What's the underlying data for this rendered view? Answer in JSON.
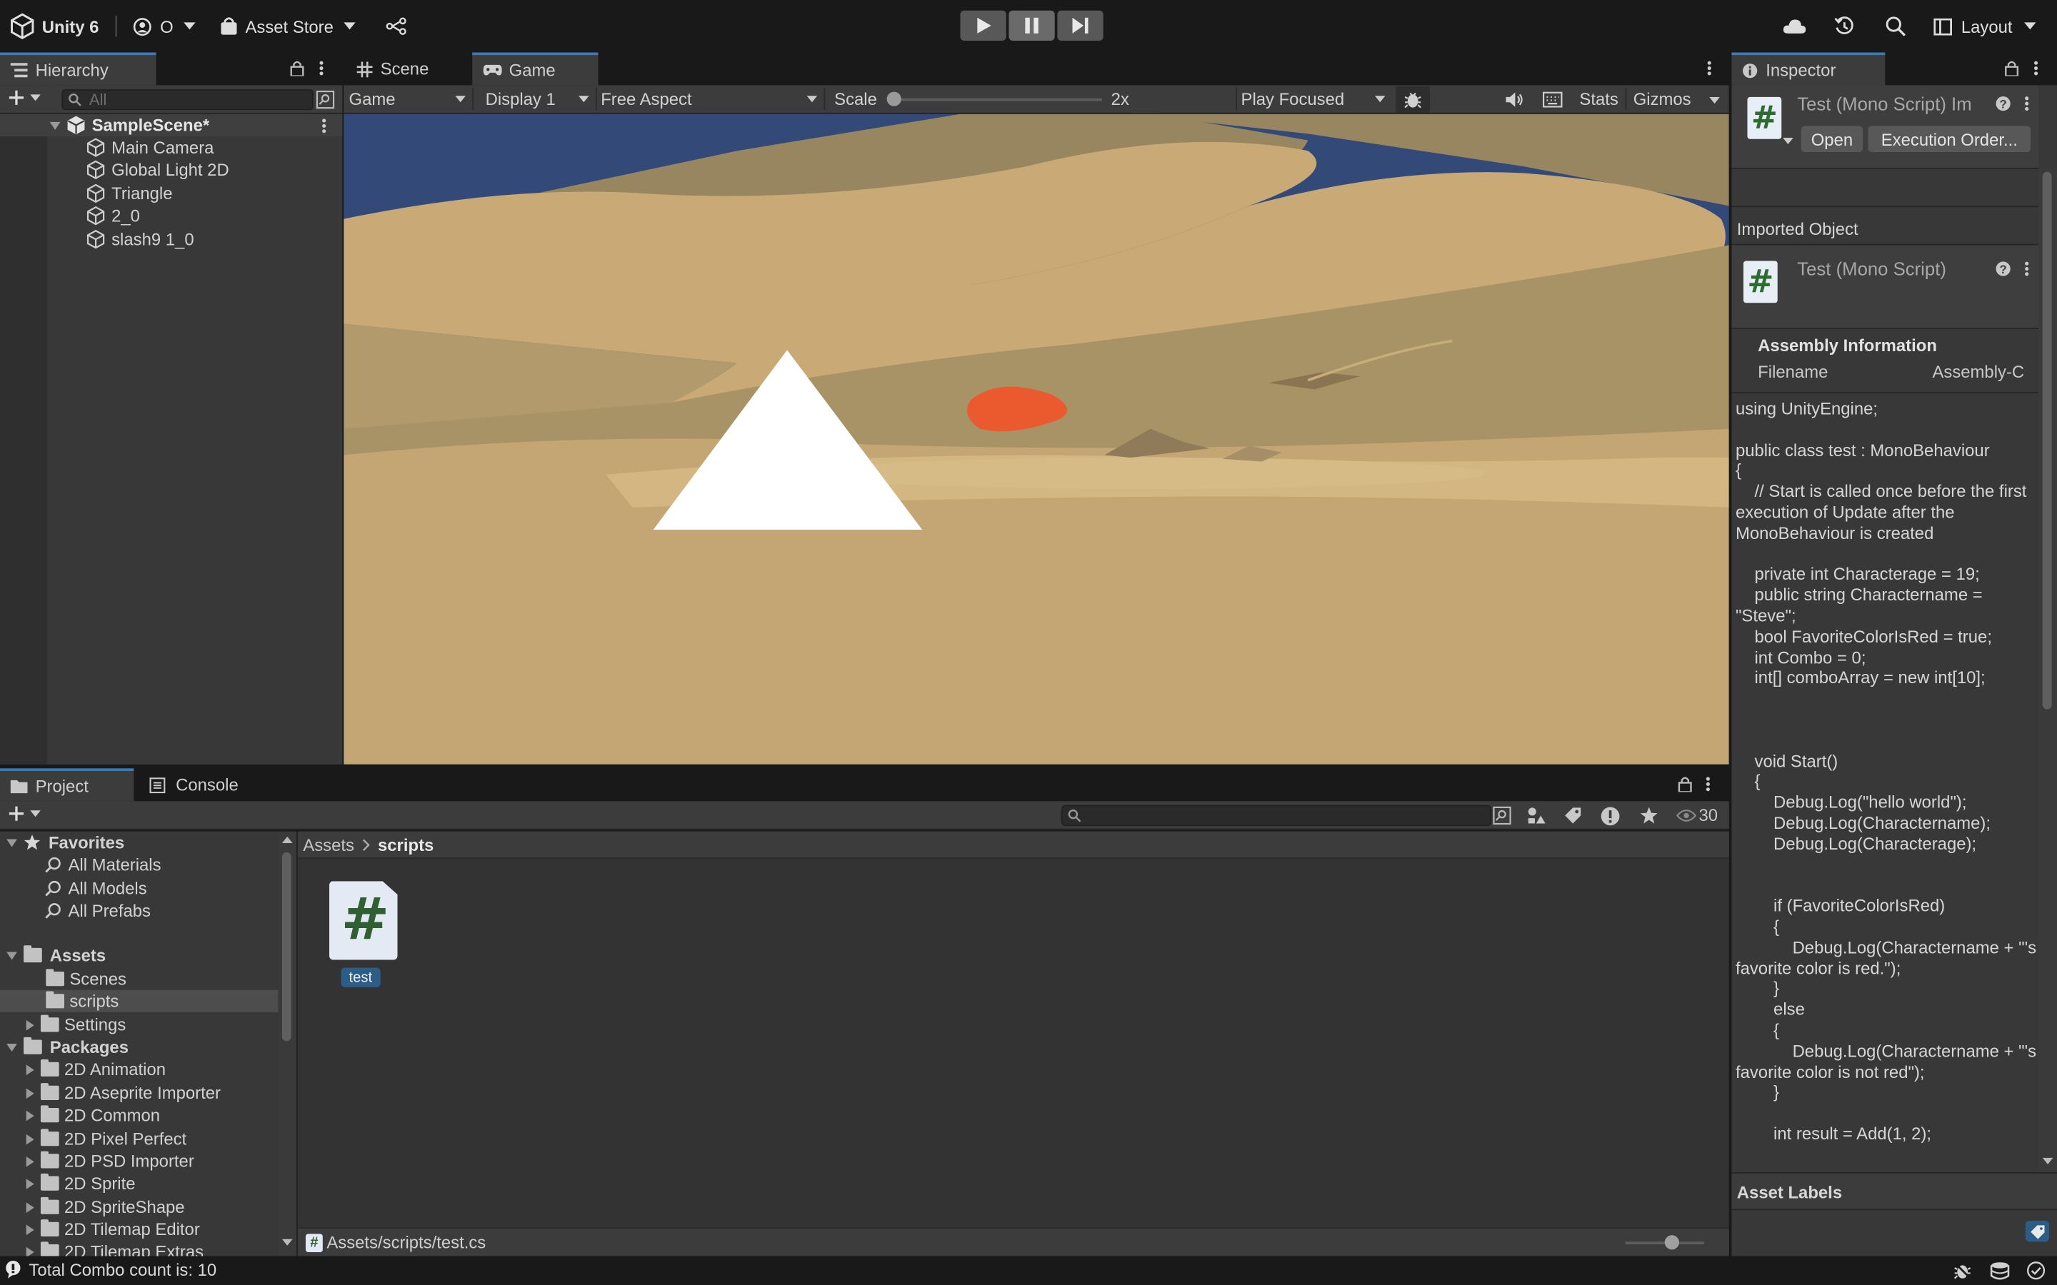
{
  "toolbar": {
    "app_name": "Unity 6",
    "account_initial": "O",
    "asset_store": "Asset Store",
    "layout": "Layout"
  },
  "hierarchy": {
    "tab": "Hierarchy",
    "search_placeholder": "All",
    "scene": "SampleScene*",
    "items": [
      "Main Camera",
      "Global Light 2D",
      "Triangle",
      "2_0",
      "slash9 1_0"
    ]
  },
  "game": {
    "tabs": {
      "scene": "Scene",
      "game": "Game"
    },
    "mode": "Game",
    "display": "Display 1",
    "aspect": "Free Aspect",
    "scale_label": "Scale",
    "scale_value": "2x",
    "play_mode": "Play Focused",
    "stats": "Stats",
    "gizmos": "Gizmos",
    "colors": {
      "sky": "#334a79",
      "dune_light": "#c9aa76",
      "dune_dark": "#978660",
      "sand_fore": "#c4a574",
      "flame": "#ea5a2e"
    }
  },
  "project": {
    "tabs": {
      "project": "Project",
      "console": "Console"
    },
    "hidden_count": "30",
    "favorites": {
      "label": "Favorites",
      "items": [
        "All Materials",
        "All Models",
        "All Prefabs"
      ]
    },
    "assets": {
      "label": "Assets",
      "items": [
        "Scenes",
        "scripts",
        "Settings"
      ]
    },
    "packages": {
      "label": "Packages",
      "items": [
        "2D Animation",
        "2D Aseprite Importer",
        "2D Common",
        "2D Pixel Perfect",
        "2D PSD Importer",
        "2D Sprite",
        "2D SpriteShape",
        "2D Tilemap Editor",
        "2D Tilemap Extras"
      ]
    },
    "breadcrumb": {
      "root": "Assets",
      "current": "scripts"
    },
    "asset_file": "test",
    "path": "Assets/scripts/test.cs"
  },
  "inspector": {
    "tab": "Inspector",
    "header_title": "Test (Mono Script) Im",
    "open": "Open",
    "execution_order": "Execution Order...",
    "imported_object": "Imported Object",
    "object_title": "Test (Mono Script)",
    "assembly_info": "Assembly Information",
    "filename_label": "Filename",
    "filename_value": "Assembly-C",
    "code": "using UnityEngine;\n\npublic class test : MonoBehaviour\n{\n    // Start is called once before the first execution of Update after the MonoBehaviour is created\n\n    private int Characterage = 19;\n    public string Charactername = \"Steve\";\n    bool FavoriteColorIsRed = true;\n    int Combo = 0;\n    int[] comboArray = new int[10];\n\n\n\n    void Start()\n    {\n        Debug.Log(\"hello world\");\n        Debug.Log(Charactername);\n        Debug.Log(Characterage);\n\n\n        if (FavoriteColorIsRed)\n        {\n            Debug.Log(Charactername + \"'s favorite color is red.\");\n        }\n        else\n        {\n            Debug.Log(Charactername + \"'s favorite color is not red\");\n        }\n\n        int result = Add(1, 2);",
    "asset_labels": "Asset Labels"
  },
  "status": {
    "message": "Total Combo count is: 10"
  }
}
